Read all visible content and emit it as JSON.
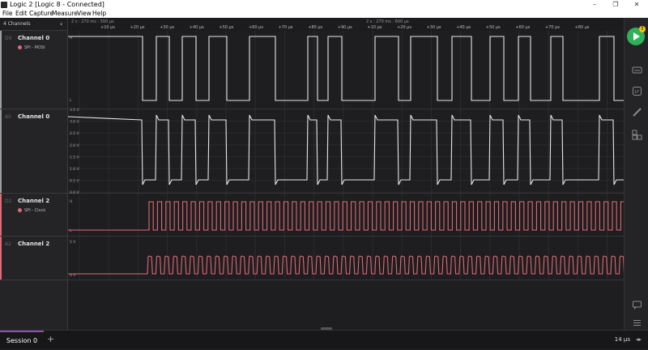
{
  "window": {
    "title": "Logic 2 [Logic 8 - Connected]",
    "minimize": "–",
    "maximize": "❐",
    "close": "✕"
  },
  "menu": [
    "File",
    "Edit",
    "Capture",
    "Measure",
    "View",
    "Help"
  ],
  "channels_header": {
    "label": "4 Channels",
    "collapse_icon": "chevron-left-icon"
  },
  "channels": [
    {
      "id": "D0",
      "name": "Channel 0",
      "analyzer": "SPI - MOSI",
      "accent": "#9aa0a6"
    },
    {
      "id": "A0",
      "name": "Channel 0",
      "accent": "#9aa0a6"
    },
    {
      "id": "D2",
      "name": "Channel 2",
      "analyzer": "SPI - Clock",
      "accent": "#e06a76"
    },
    {
      "id": "A2",
      "name": "Channel 2",
      "accent": "#e06a76"
    }
  ],
  "timeline": {
    "time_labels": [
      "2 s : 270 ms : 500 μs",
      "2 s : 270 ms : 600 μs"
    ],
    "ticks": [
      "+10 μs",
      "+20 μs",
      "+30 μs",
      "+40 μs",
      "+50 μs",
      "+60 μs",
      "+70 μs",
      "+80 μs",
      "+90 μs",
      "+10 μs",
      "+20 μs",
      "+30 μs",
      "+40 μs",
      "+50 μs",
      "+60 μs",
      "+70 μs",
      "+80 μs"
    ]
  },
  "axis_labels": {
    "d0": [
      "H",
      "L"
    ],
    "a0": [
      "3.5 V",
      "3.0 V",
      "2.5 V",
      "2.0 V",
      "1.5 V",
      "1.0 V",
      "0.5 V",
      "0.0 V"
    ],
    "d2": [
      "H",
      "L"
    ],
    "a2": [
      "5 V",
      "0 V"
    ]
  },
  "right_toolbar": [
    "play-icon",
    "waveform-icon",
    "analyzer-icon",
    "ruler-icon",
    "extensions-icon",
    "notes-icon",
    "menu-icon"
  ],
  "play_badge": "!",
  "session": {
    "tab": "Session 0",
    "add": "+"
  },
  "zoom": {
    "value": "14 μs",
    "arrows": "◂▸"
  },
  "colors": {
    "digital_white": "#e6e6e6",
    "clock_red": "#e06a76",
    "play_green": "#2fb15a",
    "badge_yellow": "#f5c400"
  }
}
